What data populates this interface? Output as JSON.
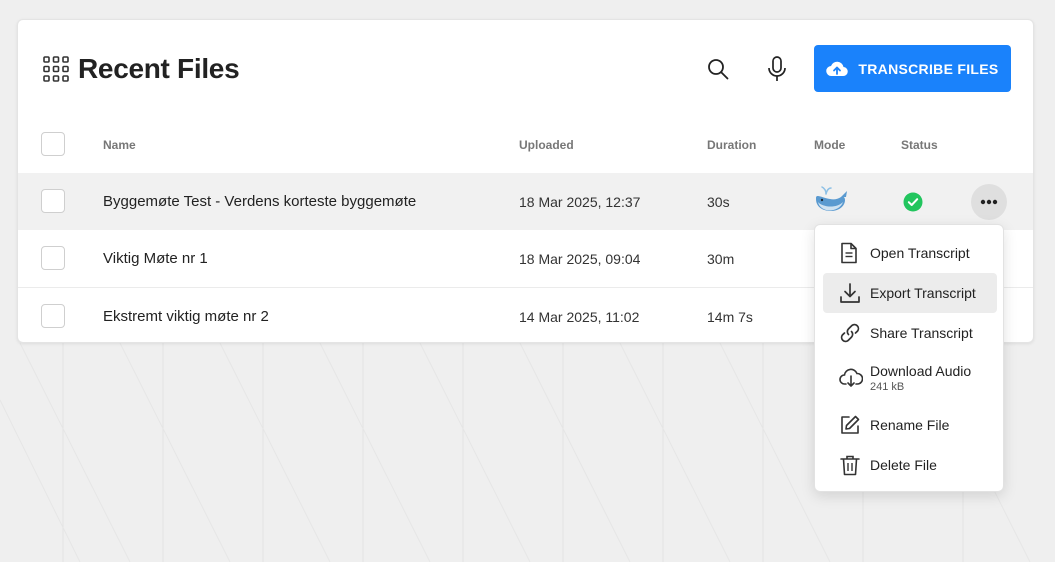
{
  "header": {
    "title": "Recent Files",
    "transcribe_label": "TRANSCRIBE FILES"
  },
  "colors": {
    "accent": "#1a82fb",
    "status_ok": "#22c55e",
    "highlight_row": "#f1f1f1"
  },
  "icons": {
    "title": "grid-icon",
    "search": "search-icon",
    "mic": "microphone-icon",
    "upload": "cloud-upload-icon",
    "mode": "whale-icon",
    "status": "check-circle-icon",
    "more": "more-horizontal-icon"
  },
  "table": {
    "columns": {
      "name": "Name",
      "uploaded": "Uploaded",
      "duration": "Duration",
      "mode": "Mode",
      "status": "Status"
    },
    "rows": [
      {
        "name": "Byggemøte Test - Verdens korteste byggemøte",
        "uploaded": "18 Mar 2025, 12:37",
        "duration": "30s",
        "mode": "whale",
        "status": "done"
      },
      {
        "name": "Viktig Møte nr 1",
        "uploaded": "18 Mar 2025, 09:04",
        "duration": "30m"
      },
      {
        "name": "Ekstremt viktig møte nr 2",
        "uploaded": "14 Mar 2025, 11:02",
        "duration": "14m 7s"
      }
    ]
  },
  "context_menu": {
    "items": [
      {
        "label": "Open Transcript",
        "icon": "document-icon"
      },
      {
        "label": "Export Transcript",
        "icon": "download-icon",
        "active": true
      },
      {
        "label": "Share Transcript",
        "icon": "link-icon"
      },
      {
        "label": "Download Audio",
        "sub": "241 kB",
        "icon": "cloud-download-icon"
      },
      {
        "label": "Rename File",
        "icon": "edit-icon"
      },
      {
        "label": "Delete File",
        "icon": "trash-icon"
      }
    ]
  }
}
